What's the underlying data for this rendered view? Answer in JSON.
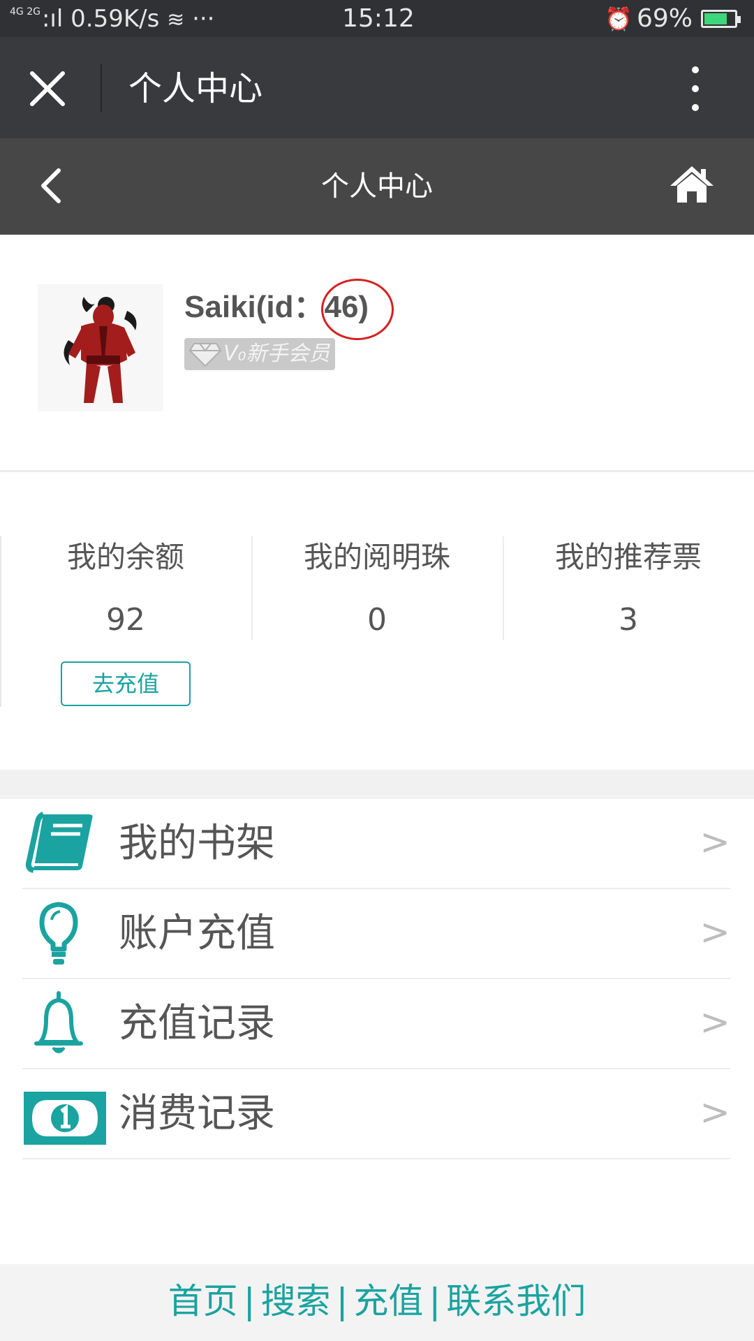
{
  "status_bar": {
    "network_prefix": "4G 2G",
    "network": ":ıl 0.59K/s",
    "extra": "···",
    "time": "15:12",
    "battery": "69%",
    "battery_level": 0.69
  },
  "wechat_bar": {
    "title": "个人中心",
    "icons": [
      "close-icon",
      "more-icon"
    ]
  },
  "page_header": {
    "title": "个人中心",
    "icons": [
      "back-icon",
      "home-icon"
    ]
  },
  "profile": {
    "name_id": "Saiki(id：46)",
    "vip_label": "V₀新手会员"
  },
  "stats": [
    {
      "label": "我的余额",
      "value": "92"
    },
    {
      "label": "我的阅明珠",
      "value": "0"
    },
    {
      "label": "我的推荐票",
      "value": "3"
    }
  ],
  "recharge_button": "去充值",
  "menu": [
    {
      "label": "我的书架",
      "icon": "book-icon",
      "arrow": ">"
    },
    {
      "label": "账户充值",
      "icon": "lightbulb-icon",
      "arrow": ">"
    },
    {
      "label": "充值记录",
      "icon": "bell-icon",
      "arrow": ">"
    },
    {
      "label": "消费记录",
      "icon": "banknote-icon",
      "arrow": ">"
    }
  ],
  "footer": {
    "links": [
      "首页",
      "搜索",
      "充值",
      "联系我们"
    ],
    "separator": "|"
  },
  "colors": {
    "accent": "#1aa3a0",
    "wechat_bar": "#393a3e",
    "page_header": "#474747",
    "annotation": "#d62020"
  }
}
